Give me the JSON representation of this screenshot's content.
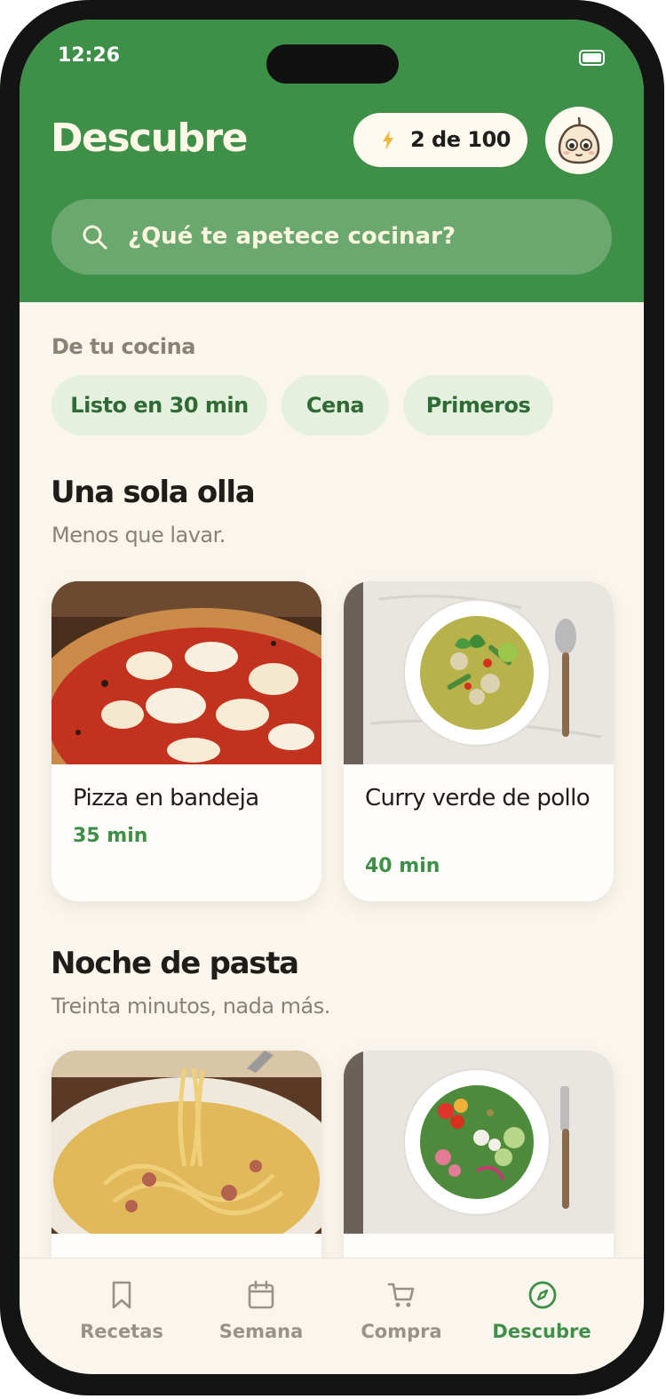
{
  "status": {
    "time": "12:26"
  },
  "header": {
    "title": "Descubre",
    "credits": "2 de 100",
    "search_placeholder": "¿Qué te apetece cocinar?"
  },
  "filters": {
    "label": "De tu cocina",
    "chips": [
      "Listo en 30 min",
      "Cena",
      "Primeros"
    ]
  },
  "sections": [
    {
      "title": "Una sola olla",
      "subtitle": "Menos que lavar.",
      "cards": [
        {
          "name": "Pizza en bandeja",
          "time": "35 min",
          "image": "pizza"
        },
        {
          "name": "Curry verde de pollo",
          "time": "40 min",
          "image": "green-curry"
        }
      ]
    },
    {
      "title": "Noche de pasta",
      "subtitle": "Treinta minutos, nada más.",
      "cards": [
        {
          "name": "",
          "time": "",
          "image": "carbonara"
        },
        {
          "name": "",
          "time": "",
          "image": "salad"
        }
      ]
    }
  ],
  "tabbar": {
    "items": [
      {
        "label": "Recetas",
        "icon": "bookmark-icon"
      },
      {
        "label": "Semana",
        "icon": "calendar-icon"
      },
      {
        "label": "Compra",
        "icon": "cart-icon"
      },
      {
        "label": "Descubre",
        "icon": "compass-icon",
        "active": true
      }
    ]
  },
  "colors": {
    "brand": "#3e8f47",
    "background": "#faf6ee",
    "chip": "#e6f0df"
  }
}
